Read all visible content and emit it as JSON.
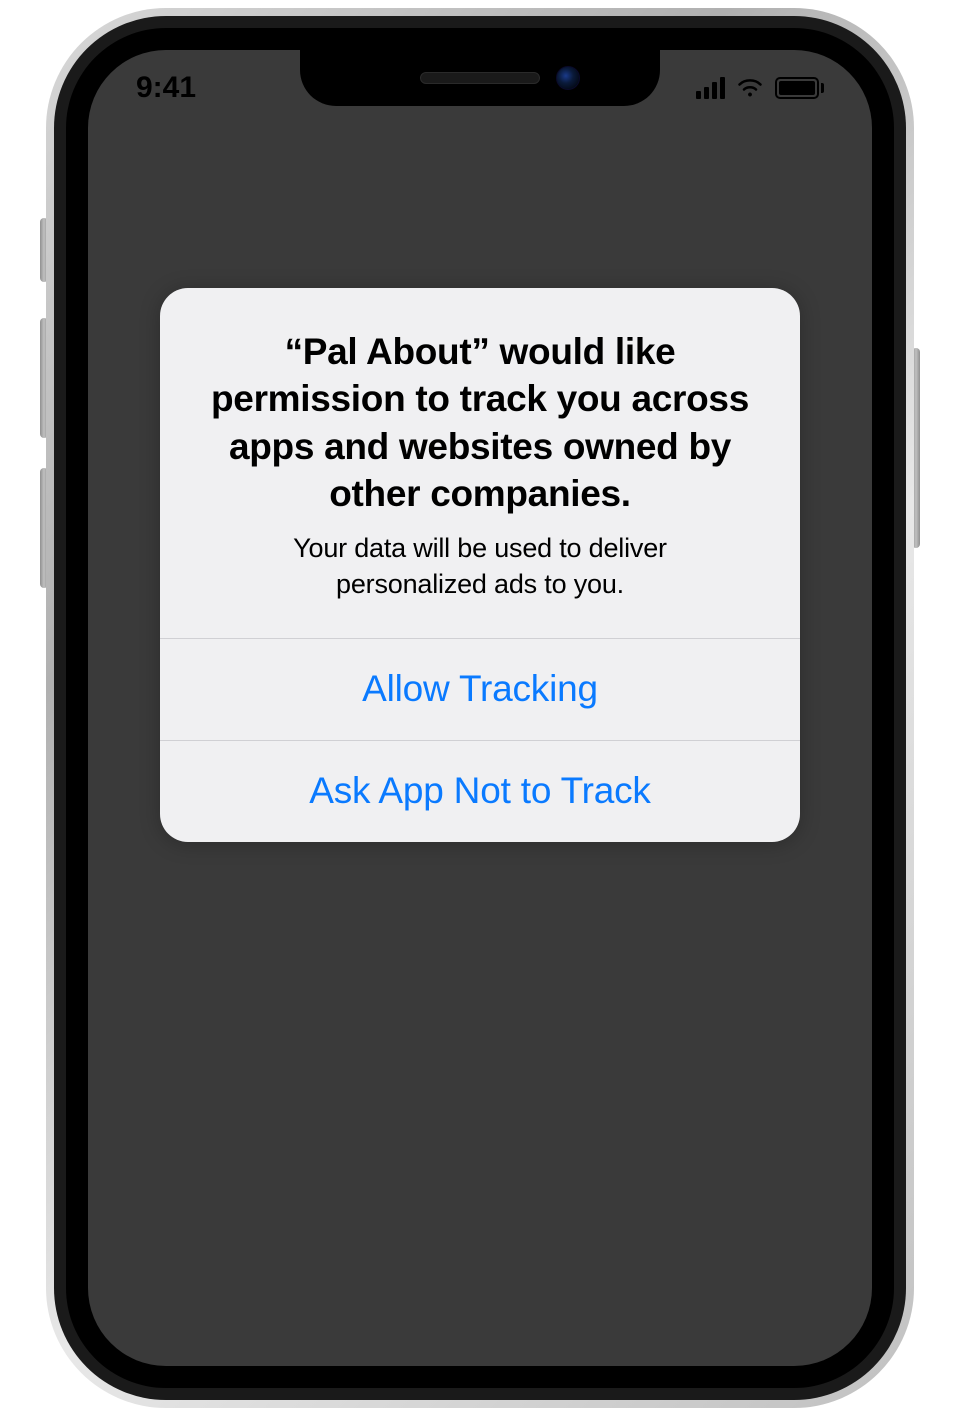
{
  "status_bar": {
    "time": "9:41"
  },
  "alert": {
    "title": "“Pal About” would like permission to track you across apps and websites owned by other companies.",
    "message": "Your data will be used to deliver personalized ads to you.",
    "allow_label": "Allow Tracking",
    "deny_label": "Ask App Not to Track"
  },
  "colors": {
    "ios_blue": "#0a7aff",
    "alert_bg": "#f0f0f2",
    "screen_bg": "#3a3a3a"
  }
}
